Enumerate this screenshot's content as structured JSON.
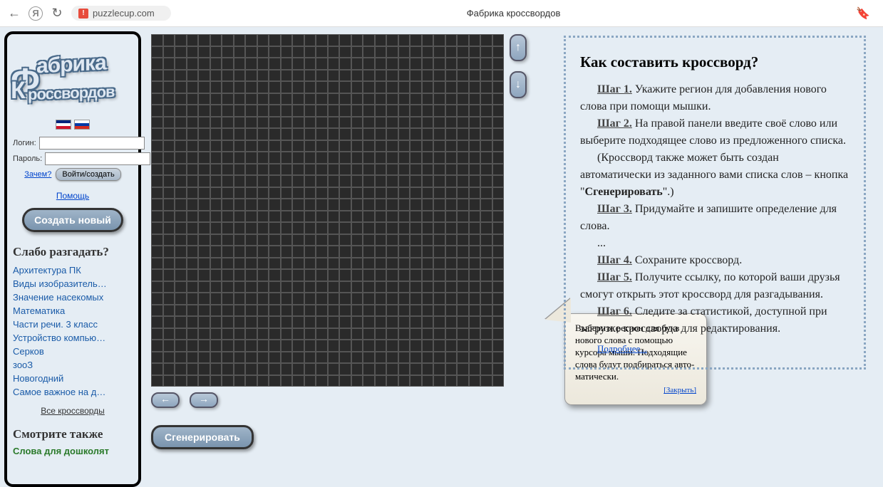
{
  "browser": {
    "url": "puzzlecup.com",
    "tab_title": "Фабрика кроссвордов"
  },
  "logo": {
    "line1": "абрика",
    "line2": "россвордов"
  },
  "login": {
    "login_label": "Логин:",
    "password_label": "Пароль:",
    "why_link": "Зачем?",
    "submit": "Войти/создать"
  },
  "help_link": "Помощь",
  "create_btn": "Создать новый",
  "solve_title": "Слабо разгадать?",
  "crosswords": [
    "Архитектура ПК",
    "Виды изобразитель…",
    "Значение насекомых",
    "Математика",
    "Части речи. 3 класс",
    "Устройство компью…",
    "Серков",
    "зооЗ",
    "Новогодний",
    "Самое важное на д…"
  ],
  "all_crosswords": "Все кроссворды",
  "see_also_title": "Смотрите также",
  "see_also_link": "Слова для дошколят",
  "generate_btn": "Сгенерировать",
  "tooltip": {
    "text": "Выберите регион для букв нового слова с по­мощью курсора мыши. Подходящие слова бу­дут подбираться авто­матически.",
    "close": "[Закрыть]"
  },
  "instructions": {
    "title": "Как составить кроссворд?",
    "step1_label": "Шаг 1.",
    "step1_text": " Укажите регион для добавления нового слова при помощи мышки.",
    "step2_label": "Шаг 2.",
    "step2_text": " На правой панели введите своё слово или выберите подходящее слово из предложенного списка.",
    "note_pre": "(Кроссворд также может быть создан автоматически из заданного вами списка слов – кнопка \"",
    "note_gen": "Сгенерировать",
    "note_post": "\".)",
    "step3_label": "Шаг 3.",
    "step3_text": " Придумайте и запишите определение для слова.",
    "ellipsis": "...",
    "step4_label": "Шаг 4.",
    "step4_text": " Сохраните кроссворд.",
    "step5_label": "Шаг 5.",
    "step5_text": " Получите ссылку, по которой ваши друзья смогут открыть этот кроссворд для разгадывания.",
    "step6_label": "Шаг 6.",
    "step6_text": " Следите за статистикой, доступной при загрузке кроссворда для редактирования.",
    "more": "Подробнее..."
  }
}
